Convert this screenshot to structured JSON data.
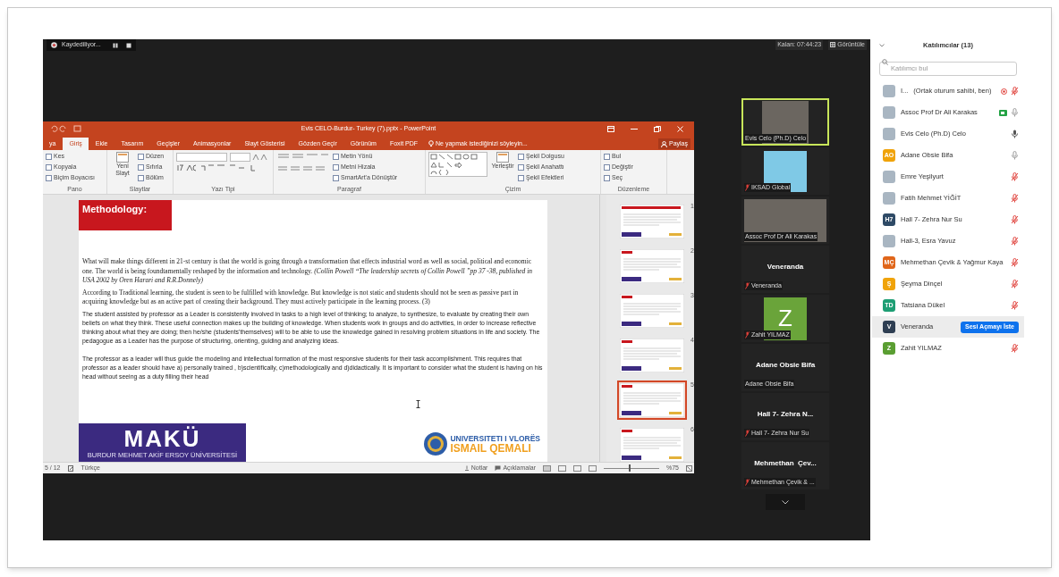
{
  "recording": {
    "label": "Kaydediliyor..."
  },
  "meeting_bar": {
    "remaining": "Kalan: 07:44:23",
    "view_button": "Görüntüle"
  },
  "ppt": {
    "title": "Evis CELO-Burdur- Turkey (7).pptx - PowerPoint",
    "share": "Paylaş",
    "search_hint": "Ne yapmak istediğinizi söyleyin...",
    "tabs": [
      {
        "label": "ya",
        "selected": false
      },
      {
        "label": "Giriş",
        "selected": true
      },
      {
        "label": "Ekle",
        "selected": false
      },
      {
        "label": "Tasarım",
        "selected": false
      },
      {
        "label": "Geçişler",
        "selected": false
      },
      {
        "label": "Animasyonlar",
        "selected": false
      },
      {
        "label": "Slayt Gösterisi",
        "selected": false
      },
      {
        "label": "Gözden Geçir",
        "selected": false
      },
      {
        "label": "Görünüm",
        "selected": false
      },
      {
        "label": "Foxit PDF",
        "selected": false
      }
    ],
    "ribbon_groups": [
      {
        "label": "Pano",
        "items": [
          "Kes",
          "Kopyala",
          "Biçim Boyacısı"
        ]
      },
      {
        "label": "Slaytlar",
        "big": "Yeni Slayt",
        "items": [
          "Düzen",
          "Sıfırla",
          "Bölüm"
        ]
      },
      {
        "label": "Yazı Tipi"
      },
      {
        "label": "Paragraf",
        "items": [
          "Metin Yönü",
          "Metni Hizala",
          "SmartArt'a Dönüştür"
        ]
      },
      {
        "label": "Çizim",
        "big": "Yerleştir",
        "items": [
          "Şekil Dolgusu",
          "Şekil Anahattı",
          "Şekil Efektleri"
        ]
      },
      {
        "label": "Düzenleme",
        "items": [
          "Bul",
          "Değiştir",
          "Seç"
        ]
      }
    ],
    "slide": {
      "title": "Methodology:",
      "paragraphs": [
        {
          "kind": "serif",
          "text": "What will make things different in 21-st century is that the world is going through a transformation that effects industrial word as well as social, political and economic one. The world is being foundtamentally reshaped by the information and technology. *(Collin Powell “The leadership secrets of Collin Powell ”pp 37 -38, published in USA 2002 by Oren Harari and R.R.Donnely)*"
        },
        {
          "kind": "serif",
          "text": "According to Traditional learning, the student is seen to be fulfilled with knowledge. But knowledge is not static and students should not be seen as passive part in acquiring knowledge but as an active part of creating their background. They must actively participate in the learning process. (3)"
        },
        {
          "kind": "sans",
          "text": "The student assisted by professor as a Leader is consistently involved in tasks to a high level of thinking; to analyze, to synthesize, to evaluate by creating their own beliefs on what they think. These useful connection makes up the building of knowledge. When students work in groups and do activities, in order to increase reflective thinking about what they are doing; then he/she (students'themselves) will to be able to use the knowledge gained in resolving problem situations in life and society. The pedagogue as a Leader has the purpose of structuring, orienting, guiding and analyzing ideas."
        },
        {
          "kind": "sans",
          "text": "The professor as a leader will thus guide the modeling and intellectual formation of the most responsive students for their task accomplishment. This requires that professor as a leader should have a) personally trained , b)scientifically, c)methodologically and d)didactically. It is important to consider what the student is having on his head without seeing as a duty filling their head"
        }
      ],
      "logo_left": "MAKÜ",
      "logo_left_sub": "BURDUR MEHMET AKİF ERSOY ÜNİVERSİTESİ",
      "logo_right_top": "UNIVERSITETI I VLORËS",
      "logo_right_bottom": "ISMAIL QEMALI"
    },
    "thumbnails": [
      {
        "number": "1",
        "selected": false
      },
      {
        "number": "2",
        "selected": false
      },
      {
        "number": "3",
        "selected": false
      },
      {
        "number": "4",
        "selected": false
      },
      {
        "number": "5",
        "selected": true
      },
      {
        "number": "6",
        "selected": false
      }
    ],
    "status": {
      "slide": "5 / 12",
      "language": "Türkçe",
      "notes": "Notlar",
      "comments": "Açıklamalar",
      "zoom": "%75",
      "level": 0.45
    }
  },
  "videos": [
    {
      "kind": "video",
      "name": "Evis Celo (Ph.D) Celo",
      "muted": false,
      "speaking": true
    },
    {
      "kind": "image",
      "name": "IKSAD Global",
      "muted": true,
      "speaking": false
    },
    {
      "kind": "video",
      "name": "Assoc Prof Dr Ali Karakas",
      "muted": false,
      "speaking": false
    },
    {
      "kind": "name",
      "title": "Veneranda",
      "name": "Veneranda",
      "muted": true,
      "speaking": false
    },
    {
      "kind": "avatar",
      "initial": "Z",
      "color": "#6aa43a",
      "name": "Zahit YILMAZ",
      "muted": true,
      "speaking": false
    },
    {
      "kind": "name",
      "title": "Adane Obsie Bifa",
      "name": "Adane Obsie Bifa",
      "muted": false,
      "speaking": false
    },
    {
      "kind": "name",
      "title": "Hall 7- Zehra N...",
      "name": "Hall 7- Zehra Nur Su",
      "muted": true,
      "speaking": false
    },
    {
      "kind": "name",
      "title": "Mehmethan  Çev...",
      "name": "Mehmethan Çevik & ...",
      "muted": true,
      "speaking": false
    }
  ],
  "participants": {
    "title": "Katılımcılar (13)",
    "search_placeholder": "Katılımcı bul",
    "items": [
      {
        "kind": "photo",
        "name": "I...",
        "note": "(Ortak oturum sahibi, ben)",
        "recording": true,
        "video": false,
        "muted": true,
        "speaking": false,
        "highlighted": false
      },
      {
        "kind": "photo",
        "name": "Assoc Prof Dr Ali Karakas",
        "recording": false,
        "video": true,
        "muted": false,
        "speaking": false,
        "highlighted": false
      },
      {
        "kind": "photo",
        "name": "Evis Celo (Ph.D) Celo",
        "recording": false,
        "video": false,
        "muted": false,
        "speaking": true,
        "highlighted": false
      },
      {
        "kind": "initials",
        "initials": "AO",
        "color": "#f0a30a",
        "name": "Adane Obsie Bifa",
        "recording": false,
        "video": false,
        "muted": false,
        "speaking": false,
        "highlighted": false
      },
      {
        "kind": "photo",
        "name": "Emre Yeşilyurt",
        "recording": false,
        "video": false,
        "muted": true,
        "speaking": false,
        "highlighted": false
      },
      {
        "kind": "photo",
        "name": "Fatih Mehmet YİĞİT",
        "recording": false,
        "video": false,
        "muted": true,
        "speaking": false,
        "highlighted": false
      },
      {
        "kind": "initials",
        "initials": "H7",
        "color": "#2e4a66",
        "name": "Hall 7- Zehra Nur Su",
        "recording": false,
        "video": false,
        "muted": true,
        "speaking": false,
        "highlighted": false
      },
      {
        "kind": "photo",
        "name": "Hall-3, Esra Yavuz",
        "recording": false,
        "video": false,
        "muted": true,
        "speaking": false,
        "highlighted": false
      },
      {
        "kind": "initials",
        "initials": "MÇ",
        "color": "#e0661a",
        "name": "Mehmethan Çevik & Yağmur Kaya",
        "recording": false,
        "video": false,
        "muted": true,
        "speaking": false,
        "highlighted": false
      },
      {
        "kind": "initials",
        "initials": "Ş",
        "color": "#f0a30a",
        "name": "Şeyma Dinçel",
        "recording": false,
        "video": false,
        "muted": true,
        "speaking": false,
        "highlighted": false
      },
      {
        "kind": "initials",
        "initials": "TD",
        "color": "#1d9e74",
        "name": "Tatsiana Dükel",
        "recording": false,
        "video": false,
        "muted": true,
        "speaking": false,
        "highlighted": false
      },
      {
        "kind": "initials",
        "initials": "V",
        "color": "#2e3e52",
        "name": "Veneranda",
        "recording": false,
        "video": false,
        "highlighted": true,
        "action": "Sesi Açmayı İste"
      },
      {
        "kind": "initials",
        "initials": "Z",
        "color": "#5a9e32",
        "name": "Zahit YILMAZ",
        "recording": false,
        "video": false,
        "muted": true,
        "speaking": false,
        "highlighted": false
      }
    ]
  }
}
